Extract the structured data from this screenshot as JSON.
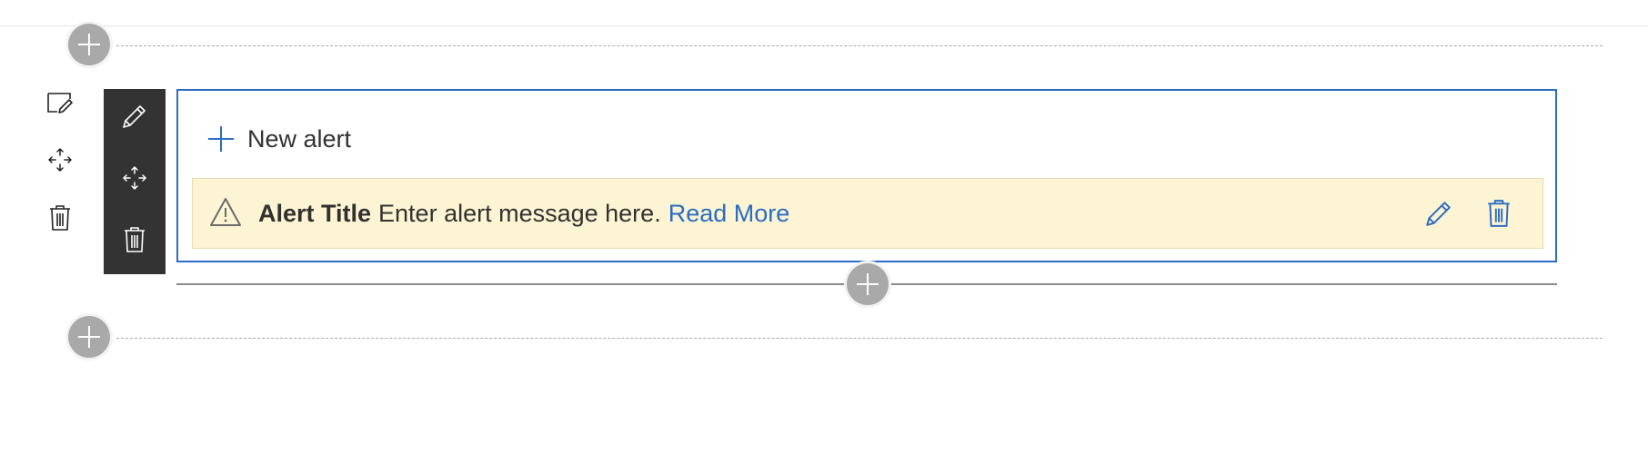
{
  "canvas": {
    "add_section_top_tooltip": "Add a new section",
    "add_section_bottom_tooltip": "Add a new section",
    "add_webpart_tooltip": "Add a new web part"
  },
  "section_toolbar": {
    "items": [
      {
        "name": "edit-section",
        "icon": "edit-section-icon"
      },
      {
        "name": "move-section",
        "icon": "move-icon"
      },
      {
        "name": "delete-section",
        "icon": "trash-icon"
      }
    ]
  },
  "webpart_toolbar": {
    "items": [
      {
        "name": "edit-webpart",
        "icon": "pencil-icon"
      },
      {
        "name": "move-webpart",
        "icon": "move-icon"
      },
      {
        "name": "delete-webpart",
        "icon": "trash-icon"
      }
    ]
  },
  "webpart": {
    "new_alert_label": "New alert",
    "alert": {
      "title": "Alert Title",
      "message": "Enter alert message here.",
      "link_text": "Read More"
    }
  },
  "colors": {
    "accent": "#2b6cc4",
    "alert_background": "#fcf4d2",
    "toolbar_background": "#333333",
    "add_circle": "#a9a9a9"
  }
}
